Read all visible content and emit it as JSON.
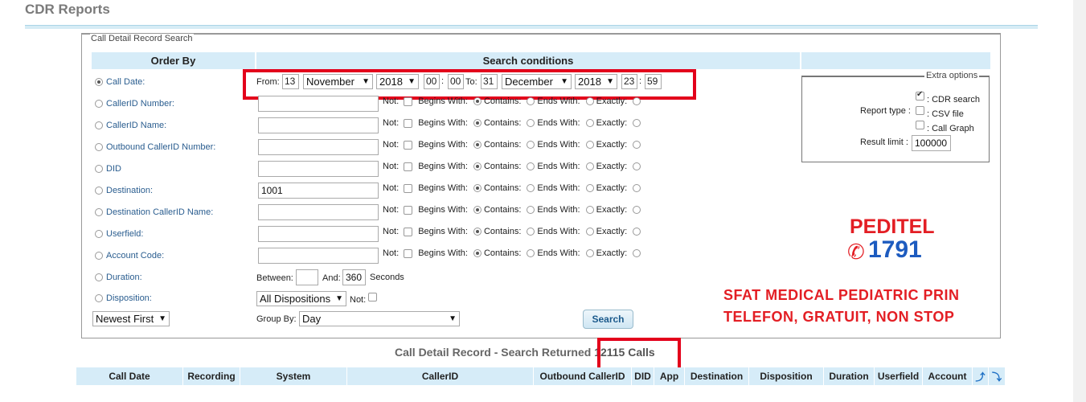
{
  "page_title": "CDR Reports",
  "search_legend": "Call Detail Record Search",
  "headers": {
    "order_by": "Order By",
    "search_conditions": "Search conditions"
  },
  "fields": [
    {
      "label": "Call Date:",
      "selected": true
    },
    {
      "label": "CallerID Number:",
      "value": ""
    },
    {
      "label": "CallerID Name:",
      "value": ""
    },
    {
      "label": "Outbound CallerID Number:",
      "value": ""
    },
    {
      "label": "DID",
      "value": ""
    },
    {
      "label": "Destination:",
      "value": "1001"
    },
    {
      "label": "Destination CallerID Name:",
      "value": ""
    },
    {
      "label": "Userfield:",
      "value": ""
    },
    {
      "label": "Account Code:",
      "value": ""
    },
    {
      "label": "Duration:"
    },
    {
      "label": "Disposition:"
    }
  ],
  "match_options": {
    "not": "Not:",
    "begins": "Begins With:",
    "contains": "Contains:",
    "ends": "Ends With:",
    "exactly": "Exactly:"
  },
  "date_range": {
    "from_label": "From:",
    "from_day": "13",
    "from_month": "November",
    "from_year": "2018",
    "from_hour": "00",
    "from_min": "00",
    "to_label": "To:",
    "to_day": "31",
    "to_month": "December",
    "to_year": "2018",
    "to_hour": "23",
    "to_min": "59"
  },
  "duration": {
    "between_label": "Between:",
    "from": "",
    "and_label": "And:",
    "to": "360",
    "unit": "Seconds"
  },
  "disposition": {
    "value": "All Dispositions",
    "not_label": "Not:"
  },
  "sort": {
    "value": "Newest First"
  },
  "group_by": {
    "label": "Group By:",
    "value": "Day"
  },
  "search_button": "Search",
  "extra_options": {
    "legend": "Extra options",
    "report_type_label": "Report type :",
    "cdr_search": ": CDR search",
    "csv_file": ": CSV file",
    "call_graph": ": Call Graph",
    "result_limit_label": "Result limit :",
    "result_limit": "100000"
  },
  "results": {
    "prefix": "Call Detail Record - Search Returned",
    "count": "12115 Calls"
  },
  "columns": [
    "Call Date",
    "Recording",
    "System",
    "CallerID",
    "Outbound CallerID",
    "DID",
    "App",
    "Destination",
    "Disposition",
    "Duration",
    "Userfield",
    "Account"
  ],
  "promo": {
    "brand": "PEDITEL",
    "number": "1791",
    "line1": "SFAT MEDICAL PEDIATRIC PRIN",
    "line2": "TELEFON, GRATUIT, NON STOP"
  },
  "accent_red": "#e3001b",
  "header_bg": "#d6ecf8"
}
